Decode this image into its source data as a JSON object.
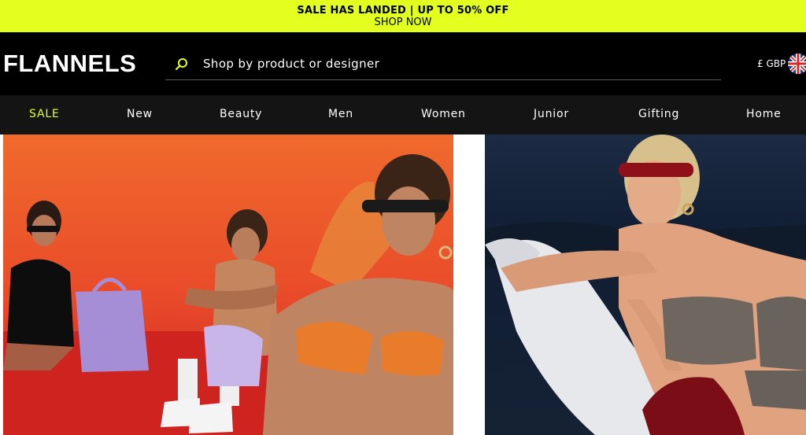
{
  "promo": {
    "title": "SALE HAS LANDED | UP TO 50% OFF",
    "link": "SHOP NOW"
  },
  "header": {
    "logo": "FLANNELS",
    "search_placeholder": "Shop by product or designer",
    "currency": "£ GBP",
    "flag_icon": "uk-flag-icon"
  },
  "nav": {
    "items": [
      {
        "label": "SALE",
        "color": "#e3ff1f"
      },
      {
        "label": "New",
        "color": "#ffffff"
      },
      {
        "label": "Beauty",
        "color": "#ffffff"
      },
      {
        "label": "Men",
        "color": "#ffffff"
      },
      {
        "label": "Women",
        "color": "#ffffff"
      },
      {
        "label": "Junior",
        "color": "#ffffff"
      },
      {
        "label": "Gifting",
        "color": "#ffffff"
      },
      {
        "label": "Home",
        "color": "#ffffff"
      }
    ]
  },
  "colors": {
    "accent": "#e3ff1f",
    "header_bg": "#000000",
    "nav_bg": "#141414"
  }
}
